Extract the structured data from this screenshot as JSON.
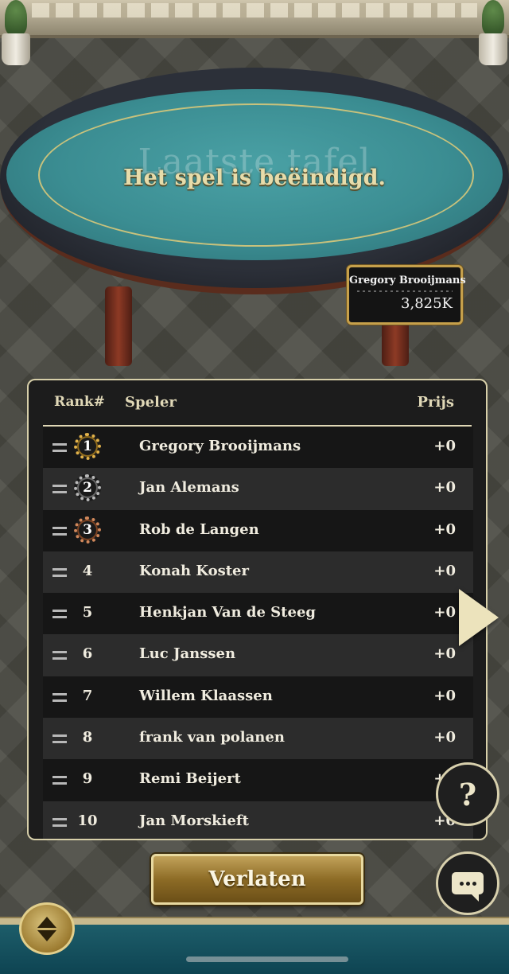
{
  "table": {
    "background_title": "Laatste tafel",
    "status_message": "Het spel is beëindigd."
  },
  "winner_plate": {
    "player_name": "Gregory Brooijmans",
    "chips": "3,825K"
  },
  "ranking": {
    "headers": {
      "rank": "Rank#",
      "player": "Speler",
      "prize": "Prijs"
    },
    "rows": [
      {
        "rank": "1",
        "player": "Gregory Brooijmans",
        "prize": "+0",
        "medal": "gold"
      },
      {
        "rank": "2",
        "player": "Jan Alemans",
        "prize": "+0",
        "medal": "silver"
      },
      {
        "rank": "3",
        "player": "Rob de Langen",
        "prize": "+0",
        "medal": "bronze"
      },
      {
        "rank": "4",
        "player": "Konah Koster",
        "prize": "+0"
      },
      {
        "rank": "5",
        "player": "Henkjan Van de Steeg",
        "prize": "+0"
      },
      {
        "rank": "6",
        "player": "Luc Janssen",
        "prize": "+0"
      },
      {
        "rank": "7",
        "player": "Willem Klaassen",
        "prize": "+0"
      },
      {
        "rank": "8",
        "player": "frank van polanen",
        "prize": "+0"
      },
      {
        "rank": "9",
        "player": "Remi Beijert",
        "prize": "+0"
      },
      {
        "rank": "10",
        "player": "Jan Morskieft",
        "prize": "+0"
      }
    ]
  },
  "buttons": {
    "leave_label": "Verlaten",
    "help_label": "?"
  },
  "icons": {
    "next": "chevron-right-icon",
    "help": "question-icon",
    "chat": "chat-bubble-icon",
    "toggle": "up-down-toggle-icon"
  },
  "colors": {
    "felt": "#3b8d92",
    "gold": "#c6a04b",
    "panel": "#1c1c1c"
  }
}
